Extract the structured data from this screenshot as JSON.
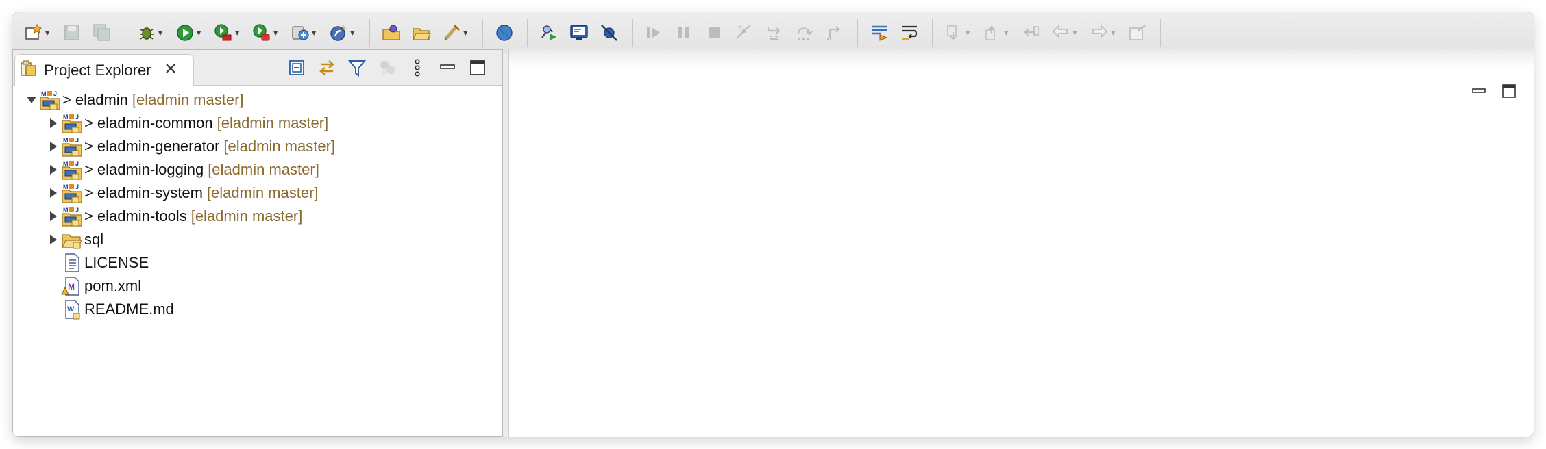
{
  "toolbar": {
    "buttons": [
      {
        "icon": "new-wizard-icon",
        "dropdown": true,
        "enabled": true
      },
      {
        "icon": "save-icon",
        "dropdown": false,
        "enabled": false
      },
      {
        "icon": "save-all-icon",
        "dropdown": false,
        "enabled": false
      },
      {
        "icon": "debug-icon",
        "dropdown": true,
        "enabled": true
      },
      {
        "icon": "run-icon",
        "dropdown": true,
        "enabled": true
      },
      {
        "icon": "run-coverage-icon",
        "dropdown": true,
        "enabled": true
      },
      {
        "icon": "external-tools-icon",
        "dropdown": true,
        "enabled": true
      },
      {
        "icon": "new-server-icon",
        "dropdown": true,
        "enabled": true
      },
      {
        "icon": "spring-icon",
        "dropdown": true,
        "enabled": true
      },
      {
        "icon": "open-type-icon",
        "dropdown": false,
        "enabled": true
      },
      {
        "icon": "open-folder-icon",
        "dropdown": false,
        "enabled": true
      },
      {
        "icon": "tasks-icon",
        "dropdown": true,
        "enabled": true
      },
      {
        "icon": "globe-icon",
        "dropdown": false,
        "enabled": true
      },
      {
        "icon": "search-run-icon",
        "dropdown": false,
        "enabled": true
      },
      {
        "icon": "console-icon",
        "dropdown": false,
        "enabled": true
      },
      {
        "icon": "skip-breakpoints-icon",
        "dropdown": false,
        "enabled": true
      },
      {
        "icon": "resume-icon",
        "dropdown": false,
        "enabled": false
      },
      {
        "icon": "suspend-icon",
        "dropdown": false,
        "enabled": false
      },
      {
        "icon": "terminate-icon",
        "dropdown": false,
        "enabled": false
      },
      {
        "icon": "disconnect-icon",
        "dropdown": false,
        "enabled": false
      },
      {
        "icon": "step-into-icon",
        "dropdown": false,
        "enabled": false
      },
      {
        "icon": "step-over-icon",
        "dropdown": false,
        "enabled": false
      },
      {
        "icon": "step-return-icon",
        "dropdown": false,
        "enabled": false
      },
      {
        "icon": "toggle-mark-occurrences-icon",
        "dropdown": false,
        "enabled": true
      },
      {
        "icon": "toggle-word-wrap-icon",
        "dropdown": false,
        "enabled": true
      },
      {
        "icon": "next-annotation-icon",
        "dropdown": true,
        "enabled": false
      },
      {
        "icon": "previous-annotation-icon",
        "dropdown": true,
        "enabled": false
      },
      {
        "icon": "last-edit-location-icon",
        "dropdown": false,
        "enabled": false
      },
      {
        "icon": "back-icon",
        "dropdown": true,
        "enabled": false
      },
      {
        "icon": "forward-icon",
        "dropdown": true,
        "enabled": false
      },
      {
        "icon": "pin-editor-icon",
        "dropdown": false,
        "enabled": false
      }
    ]
  },
  "explorer": {
    "tab_label": "Project Explorer",
    "actions": [
      "collapse-all-icon",
      "link-with-editor-icon",
      "filter-icon",
      "focus-icon",
      "view-menu-icon",
      "minimize-icon",
      "maximize-icon"
    ],
    "tree": [
      {
        "label": "eladmin",
        "decoration": "[eladmin master]",
        "prefix": ">",
        "type": "maven-project",
        "expanded": true,
        "level": 0,
        "has_children": true
      },
      {
        "label": "eladmin-common",
        "decoration": "[eladmin master]",
        "prefix": ">",
        "type": "maven-project",
        "expanded": false,
        "level": 1,
        "has_children": true
      },
      {
        "label": "eladmin-generator",
        "decoration": "[eladmin master]",
        "prefix": ">",
        "type": "maven-project",
        "expanded": false,
        "level": 1,
        "has_children": true
      },
      {
        "label": "eladmin-logging",
        "decoration": "[eladmin master]",
        "prefix": ">",
        "type": "maven-project",
        "expanded": false,
        "level": 1,
        "has_children": true
      },
      {
        "label": "eladmin-system",
        "decoration": "[eladmin master]",
        "prefix": ">",
        "type": "maven-project",
        "expanded": false,
        "level": 1,
        "has_children": true
      },
      {
        "label": "eladmin-tools",
        "decoration": "[eladmin master]",
        "prefix": ">",
        "type": "maven-project",
        "expanded": false,
        "level": 1,
        "has_children": true
      },
      {
        "label": "sql",
        "decoration": "",
        "prefix": "",
        "type": "folder",
        "expanded": false,
        "level": 1,
        "has_children": true
      },
      {
        "label": "LICENSE",
        "decoration": "",
        "prefix": "",
        "type": "text-file",
        "expanded": false,
        "level": 1,
        "has_children": false
      },
      {
        "label": "pom.xml",
        "decoration": "",
        "prefix": "",
        "type": "xml-file",
        "expanded": false,
        "level": 1,
        "has_children": false
      },
      {
        "label": "README.md",
        "decoration": "",
        "prefix": "",
        "type": "markdown-file",
        "expanded": false,
        "level": 1,
        "has_children": false
      }
    ]
  },
  "colors": {
    "decoration": "#8a6a2f",
    "toolbar_bg": "#e6e6e6",
    "panel_border": "#b9b9b9"
  }
}
